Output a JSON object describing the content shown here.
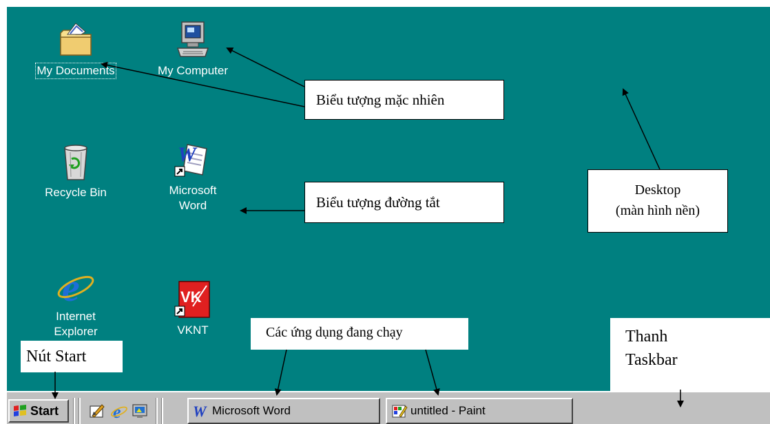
{
  "desktop": {
    "icons": [
      {
        "id": "my-documents",
        "label": "My Documents",
        "icon": "folder-documents-icon"
      },
      {
        "id": "my-computer",
        "label": "My Computer",
        "icon": "computer-icon"
      },
      {
        "id": "recycle-bin",
        "label": "Recycle Bin",
        "icon": "recycle-bin-icon"
      },
      {
        "id": "microsoft-word",
        "label": "Microsoft\nWord",
        "icon": "word-shortcut-icon"
      },
      {
        "id": "internet-explorer",
        "label": "Internet\nExplorer",
        "icon": "internet-explorer-icon"
      },
      {
        "id": "vknt",
        "label": "VKNT",
        "icon": "vknt-shortcut-icon"
      }
    ],
    "background_color": "#008080"
  },
  "annotations": {
    "default_icons": "Biểu tượng mặc nhiên",
    "shortcut_icons": "Biểu tượng đường tắt",
    "desktop_line1": "Desktop",
    "desktop_line2": "(màn hình nền)",
    "running_apps": "Các ứng dụng đang chạy",
    "start_button": "Nút Start",
    "taskbar_line1": "Thanh",
    "taskbar_line2": "Taskbar"
  },
  "taskbar": {
    "start_label": "Start",
    "quick_launch": [
      "show-desktop-icon",
      "internet-explorer-icon",
      "channels-icon"
    ],
    "tasks": [
      {
        "label": "Microsoft Word",
        "icon": "word-icon"
      },
      {
        "label": "untitled - Paint",
        "icon": "paint-icon"
      }
    ],
    "background_color": "#c0c0c0"
  }
}
